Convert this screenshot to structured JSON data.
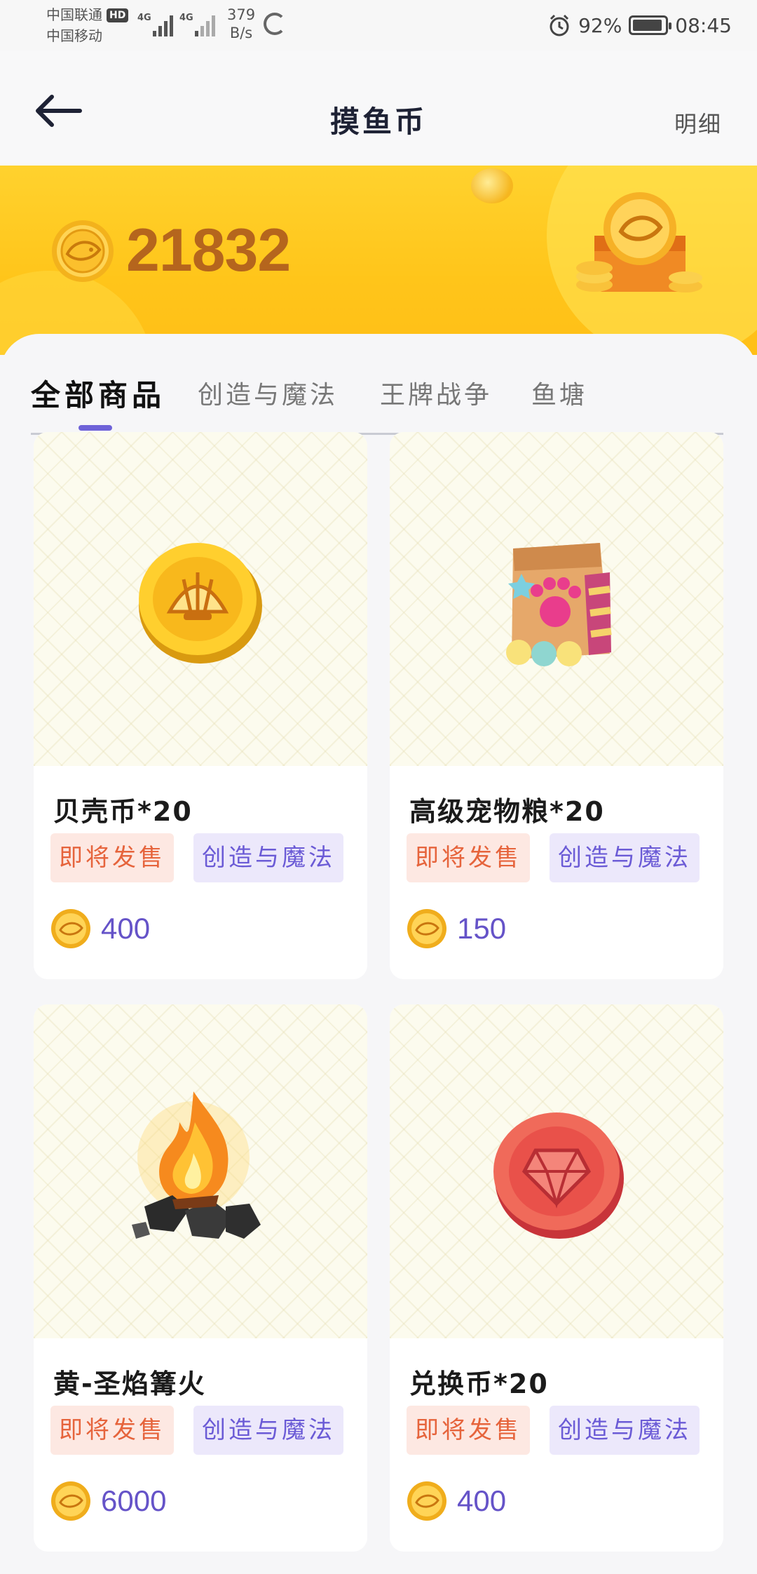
{
  "status_bar": {
    "carrier_1": "中国联通",
    "carrier_2": "中国移动",
    "hd_badge": "HD",
    "network_1": "4G",
    "network_2": "4G",
    "net_speed_value": "379",
    "net_speed_unit": "B/s",
    "battery_percent": "92%",
    "battery_level": 0.92,
    "time": "08:45"
  },
  "header": {
    "title": "摸鱼币",
    "detail_link": "明细"
  },
  "banner": {
    "balance": "21832",
    "accent_color": "#ffc51a",
    "balance_color": "#b5651d"
  },
  "tabs": [
    {
      "label": "全部商品",
      "active": true
    },
    {
      "label": "创造与魔法",
      "active": false
    },
    {
      "label": "王牌战争",
      "active": false
    },
    {
      "label": "鱼塘",
      "active": false
    }
  ],
  "products": [
    {
      "name": "贝壳币*20",
      "status_tag": "即将发售",
      "category_tag": "创造与魔法",
      "price": "400",
      "icon": "shell-coin-icon"
    },
    {
      "name": "高级宠物粮*20",
      "status_tag": "即将发售",
      "category_tag": "创造与魔法",
      "price": "150",
      "icon": "pet-food-bag-icon"
    },
    {
      "name": "黄-圣焰篝火",
      "status_tag": "即将发售",
      "category_tag": "创造与魔法",
      "price": "6000",
      "icon": "campfire-icon"
    },
    {
      "name": "兑换币*20",
      "status_tag": "即将发售",
      "category_tag": "创造与魔法",
      "price": "400",
      "icon": "exchange-coin-icon"
    }
  ],
  "colors": {
    "tab_indicator": "#6e62d8",
    "soon_tag_text": "#e6643c",
    "category_tag_text": "#6b5bd6",
    "price_text": "#6553c8"
  }
}
